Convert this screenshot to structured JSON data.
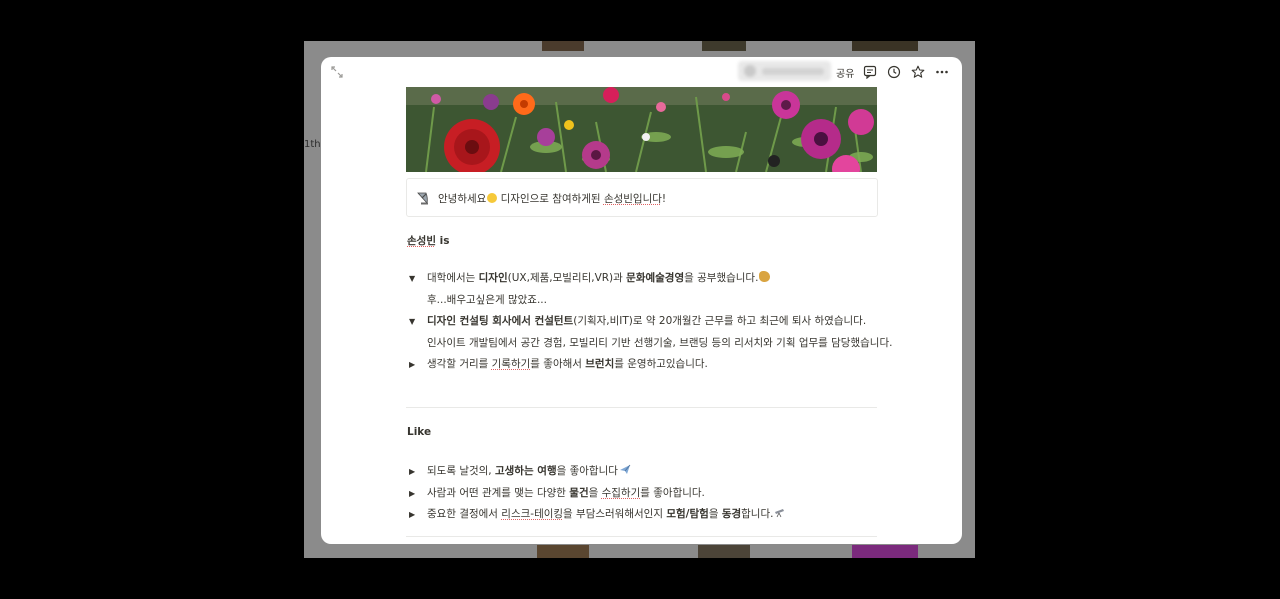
{
  "background": {
    "side_label": "1th"
  },
  "topbar": {
    "share_label": "공유"
  },
  "callout": {
    "text_before": "안녕하세요",
    "text_after": " 디자인으로 참여하게된 ",
    "name": "손성빈입니다",
    "end": "!"
  },
  "section1": {
    "heading_name": "손성빈",
    "heading_rest": " is",
    "items": [
      {
        "toggle": "▼",
        "p1": "대학에서는 ",
        "b1": "디자인",
        "p2": "(UX,제품,모빌리티,VR)과 ",
        "b2": "문화예술경영",
        "p3": "을 공부했습니다.",
        "sub": "후...배우고싶은게 많았죠..."
      },
      {
        "toggle": "▼",
        "b1": "디자인 컨설팅 회사에서 컨설턴트",
        "p2": "(기획자,비IT)로 약 20개월간 근무를 하고 최근에 퇴사 하였습니다.",
        "sub": "인사이트 개발팀에서 공간 경험, 모빌리티 기반 선행기술, 브랜딩 등의 리서치와 기획 업무를 담당했습니다."
      },
      {
        "toggle": "▶",
        "p1": "생각할 거리를 ",
        "u1": "기록하기",
        "p2": "를 좋아해서 ",
        "b1": "브런치",
        "p3": "를 운영하고있습니다."
      }
    ]
  },
  "section2": {
    "heading": "Like",
    "items": [
      {
        "toggle": "▶",
        "p1": "되도록 날것의, ",
        "b1": "고생하는 여행",
        "p2": "을 좋아합니다"
      },
      {
        "toggle": "▶",
        "p1": "사람과 어떤 관계를 맺는 다양한 ",
        "b1": "물건",
        "p2": "을 ",
        "u1": "수집하기",
        "p3": "를 좋아합니다."
      },
      {
        "toggle": "▶",
        "p1": "중요한 결정에서 ",
        "u1": "리스크-테이킹",
        "p2": "을 부담스러워해서인지 ",
        "b1": "모험/탐험",
        "p3": "을 ",
        "b2": "동경",
        "p4": "합니다."
      }
    ]
  },
  "colors": {
    "text": "#37352f",
    "divider": "#e9e9e7",
    "spell_underline": "#e06060"
  }
}
